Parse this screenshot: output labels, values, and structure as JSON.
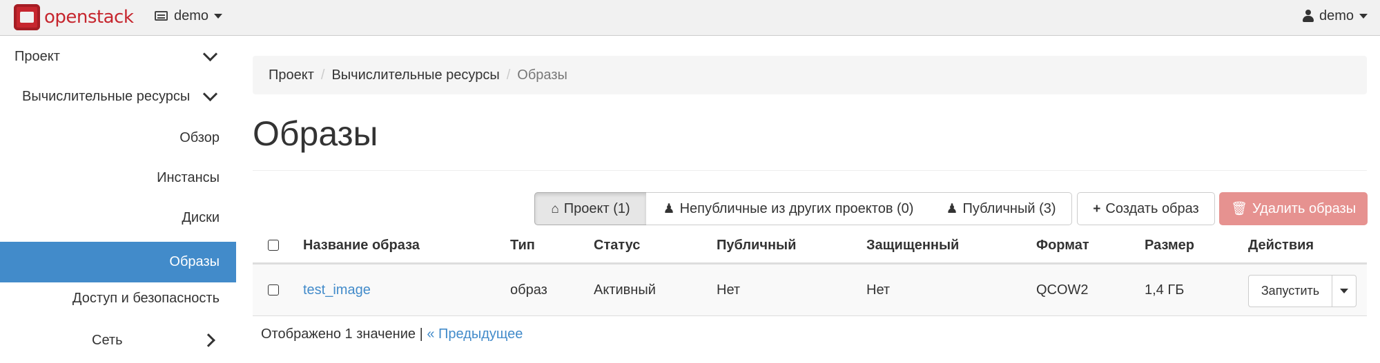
{
  "topbar": {
    "logo_text": "openstack",
    "project": "demo",
    "user": "demo"
  },
  "sidebar": {
    "items": [
      {
        "label": "Проект"
      },
      {
        "label": "Вычислительные ресурсы"
      },
      {
        "label": "Обзор"
      },
      {
        "label": "Инстансы"
      },
      {
        "label": "Диски"
      },
      {
        "label": "Образы"
      },
      {
        "label": "Доступ и безопасность"
      },
      {
        "label": "Сеть"
      }
    ]
  },
  "breadcrumb": {
    "items": [
      "Проект",
      "Вычислительные ресурсы",
      "Образы"
    ],
    "separator": "/"
  },
  "page_title": "Образы",
  "filters": {
    "project": "Проект (1)",
    "shared": "Непубличные из других проектов (0)",
    "public": "Публичный (3)",
    "create": "Создать образ",
    "delete": "Удалить образы"
  },
  "table": {
    "headers": [
      "Название образа",
      "Тип",
      "Статус",
      "Публичный",
      "Защищенный",
      "Формат",
      "Размер",
      "Действия"
    ],
    "rows": [
      {
        "name": "test_image",
        "type": "образ",
        "status": "Активный",
        "public": "Нет",
        "protected": "Нет",
        "format": "QCOW2",
        "size": "1,4 ГБ",
        "action": "Запустить"
      }
    ]
  },
  "footer": {
    "count": "Отображено 1 значение",
    "separator": "|",
    "prev": "« Предыдущее"
  },
  "colors": {
    "accent": "#428bca",
    "brand": "#c6262e",
    "danger": "#e69290"
  }
}
